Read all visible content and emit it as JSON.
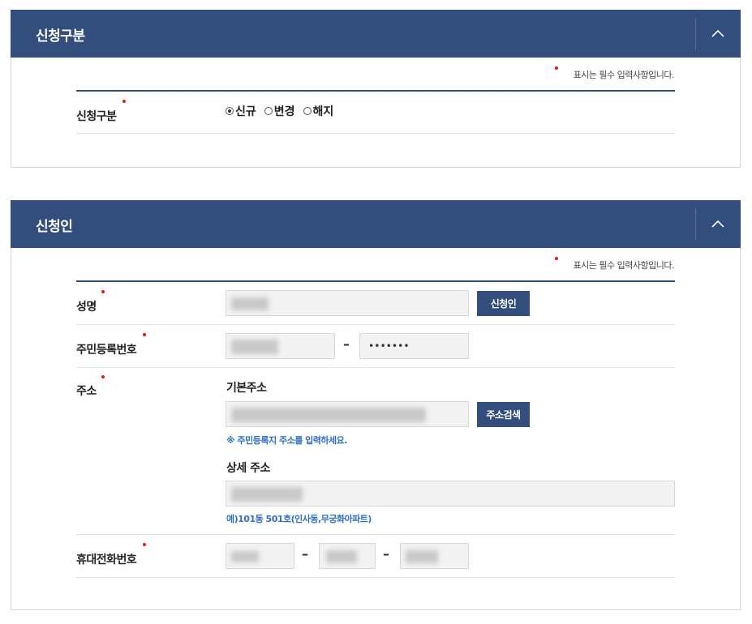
{
  "sections": {
    "application_type": {
      "title": "신청구분",
      "required_note": "표시는 필수 입력사항입니다.",
      "field_label": "신청구분",
      "options": [
        {
          "label": "신규",
          "selected": true
        },
        {
          "label": "변경",
          "selected": false
        },
        {
          "label": "해지",
          "selected": false
        }
      ]
    },
    "applicant": {
      "title": "신청인",
      "required_note": "표시는 필수 입력사항입니다.",
      "name_label": "성명",
      "name_button": "신청인",
      "rrn_label": "주민등록번호",
      "rrn_separator": "–",
      "rrn_back_value": "•••••••",
      "address_label": "주소",
      "basic_address_label": "기본주소",
      "address_search_button": "주소검색",
      "basic_address_hint": "※ 주민등록지 주소를 입력하세요.",
      "detail_address_label": "상세 주소",
      "detail_address_hint": "예)101동 501호(인사동,무궁화아파트)",
      "phone_label": "휴대전화번호",
      "phone_separator": "–"
    }
  },
  "colors": {
    "header_bg": "#334e7d",
    "required_dot": "#e31b1b",
    "hint_text": "#2f6fc4"
  },
  "icons": {
    "collapse": "chevron-up-icon"
  }
}
